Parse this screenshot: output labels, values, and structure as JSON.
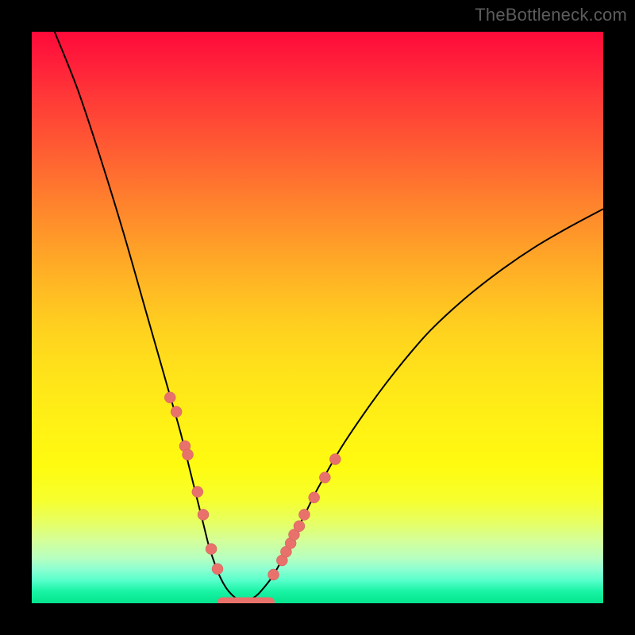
{
  "watermark": "TheBottleneck.com",
  "colors": {
    "gradient_top": "#ff0a3a",
    "gradient_mid": "#ffe31a",
    "gradient_bottom": "#05e48e",
    "curve": "#000000",
    "bead": "#e9716c",
    "frame": "#000000"
  },
  "chart_data": {
    "type": "line",
    "title": "",
    "xlabel": "",
    "ylabel": "",
    "xlim": [
      0,
      100
    ],
    "ylim": [
      0,
      100
    ],
    "grid": false,
    "series": [
      {
        "name": "left-curve",
        "x": [
          4,
          8,
          12,
          16,
          20,
          22,
          24,
          26,
          28,
          30,
          31,
          32,
          33,
          34,
          35,
          36,
          37
        ],
        "y": [
          100,
          90,
          78,
          65,
          51,
          44,
          37,
          30,
          22,
          14,
          10,
          7,
          4.5,
          2.7,
          1.5,
          0.7,
          0.2
        ]
      },
      {
        "name": "right-curve",
        "x": [
          37,
          38,
          39,
          40,
          42,
          44,
          46,
          48,
          50,
          54,
          58,
          62,
          66,
          70,
          76,
          82,
          88,
          94,
          100
        ],
        "y": [
          0.2,
          0.5,
          1.1,
          2,
          4.5,
          8,
          12,
          16,
          20,
          27,
          33,
          38.5,
          43.5,
          48,
          53.5,
          58.2,
          62.3,
          65.8,
          69
        ]
      }
    ],
    "markers_left": {
      "x": [
        24.2,
        25.3,
        26.8,
        27.3,
        29.0,
        30.0,
        31.4,
        32.5
      ],
      "y": [
        36,
        33.5,
        27.5,
        26,
        19.5,
        15.5,
        9.5,
        6
      ]
    },
    "markers_right": {
      "x": [
        42.3,
        43.8,
        44.5,
        45.3,
        45.9,
        46.8,
        47.7,
        49.4,
        51.3,
        53.1
      ],
      "y": [
        5,
        7.5,
        9,
        10.5,
        12,
        13.5,
        15.5,
        18.5,
        22,
        25.2
      ]
    },
    "bottom_bar": {
      "x0": 32.5,
      "x1": 42.5,
      "y": 0.2
    }
  }
}
